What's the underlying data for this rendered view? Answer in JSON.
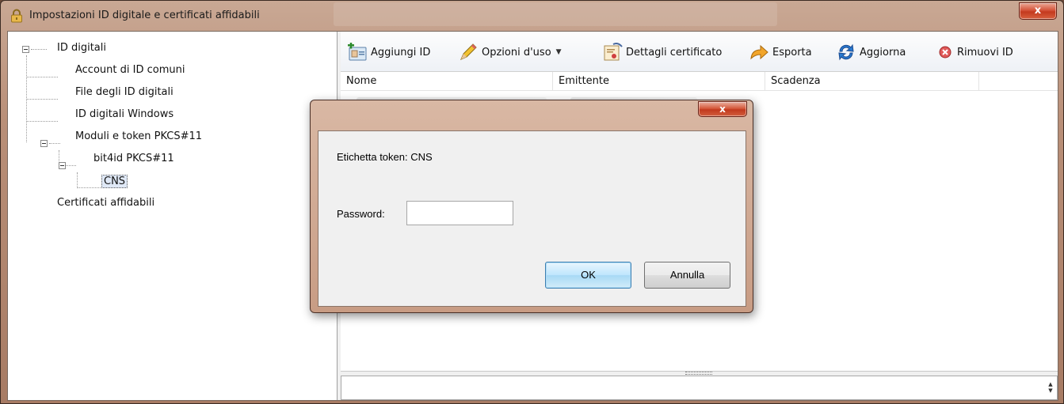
{
  "window": {
    "title": "Impostazioni ID digitale e certificati affidabili",
    "close_label": "x"
  },
  "tree": {
    "items": [
      {
        "label": "ID digitali"
      },
      {
        "label": "Account di ID comuni"
      },
      {
        "label": "File degli ID digitali"
      },
      {
        "label": "ID digitali Windows"
      },
      {
        "label": "Moduli e token PKCS#11"
      },
      {
        "label": "bit4id PKCS#11"
      },
      {
        "label": "CNS"
      },
      {
        "label": "Certificati affidabili"
      }
    ]
  },
  "toolbar": {
    "add_id": "Aggiungi ID",
    "usage_options": "Opzioni d'uso",
    "certificate_details": "Dettagli certificato",
    "export": "Esporta",
    "refresh": "Aggiorna",
    "remove_id": "Rimuovi ID"
  },
  "columns": [
    "Nome",
    "Emittente",
    "Scadenza"
  ],
  "dialog": {
    "close_label": "x",
    "token_label": "Etichetta token: CNS",
    "password_label": "Password:",
    "password_value": "",
    "ok_label": "OK",
    "cancel_label": "Annulla"
  },
  "colors": {
    "frame": "#b98f78",
    "ok_button_border": "#3c7fb1",
    "close_button": "#c43a1e"
  }
}
